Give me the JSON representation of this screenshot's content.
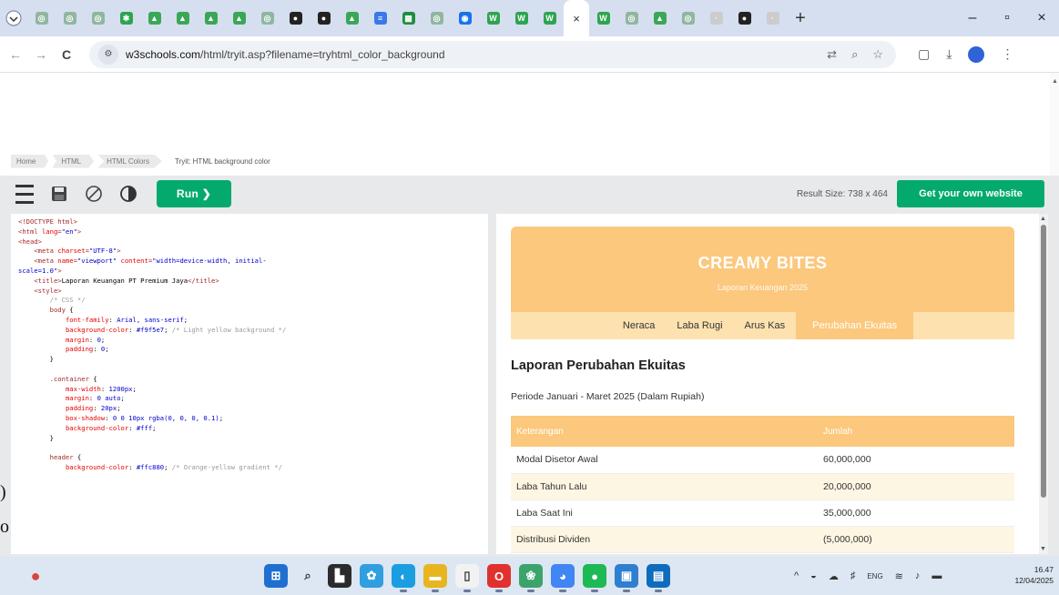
{
  "browser": {
    "tabs": [
      {
        "icon": "w3schools-icon",
        "color": "#8fb7a0",
        "glyph": "◎"
      },
      {
        "icon": "w3schools-icon",
        "color": "#8fb7a0",
        "glyph": "◎"
      },
      {
        "icon": "w3schools-icon",
        "color": "#8fb7a0",
        "glyph": "◎"
      },
      {
        "icon": "green-star-icon",
        "color": "#2ea44f",
        "glyph": "✱"
      },
      {
        "icon": "drive-icon",
        "color": "#3aa757",
        "glyph": "▲"
      },
      {
        "icon": "drive-icon",
        "color": "#3aa757",
        "glyph": "▲"
      },
      {
        "icon": "drive-icon",
        "color": "#3aa757",
        "glyph": "▲"
      },
      {
        "icon": "drive-icon",
        "color": "#3aa757",
        "glyph": "▲"
      },
      {
        "icon": "w3schools-icon",
        "color": "#8fb7a0",
        "glyph": "◎"
      },
      {
        "icon": "openai-icon",
        "color": "#222222",
        "glyph": "●"
      },
      {
        "icon": "openai-icon",
        "color": "#222222",
        "glyph": "●"
      },
      {
        "icon": "drive-icon",
        "color": "#3aa757",
        "glyph": "▲"
      },
      {
        "icon": "docs-icon",
        "color": "#3b78e7",
        "glyph": "≡"
      },
      {
        "icon": "sheets-icon",
        "color": "#1e8e3e",
        "glyph": "▦"
      },
      {
        "icon": "w3schools-icon",
        "color": "#8fb7a0",
        "glyph": "◎"
      },
      {
        "icon": "messenger-icon",
        "color": "#1a73e8",
        "glyph": "◉"
      },
      {
        "icon": "word-icon",
        "color": "#2ea44f",
        "glyph": "W"
      },
      {
        "icon": "word-icon",
        "color": "#2ea44f",
        "glyph": "W"
      },
      {
        "icon": "word-icon",
        "color": "#2ea44f",
        "glyph": "W"
      },
      {
        "icon": "close-icon",
        "color": "active",
        "glyph": "×"
      },
      {
        "icon": "word-icon",
        "color": "#2ea44f",
        "glyph": "W"
      },
      {
        "icon": "w3schools-icon",
        "color": "#8fb7a0",
        "glyph": "◎"
      },
      {
        "icon": "drive-icon",
        "color": "#3aa757",
        "glyph": "▲"
      },
      {
        "icon": "w3schools-icon",
        "color": "#8fb7a0",
        "glyph": "◎"
      },
      {
        "icon": "blank-icon",
        "color": "#cccccc",
        "glyph": "·"
      },
      {
        "icon": "openai-icon",
        "color": "#222222",
        "glyph": "●"
      },
      {
        "icon": "blank-icon",
        "color": "#cccccc",
        "glyph": "·"
      }
    ],
    "new_tab": "+",
    "window_buttons": {
      "minimize": "–",
      "maximize": "▫",
      "close": "×"
    },
    "nav": {
      "back": "←",
      "forward": "→",
      "reload": "C"
    },
    "url_host": "w3schools.com",
    "url_path": "/html/tryit.asp?filename=tryhtml_color_background",
    "url_icons": {
      "translate": "⇄",
      "zoom": "⌕",
      "bookmark": "☆"
    },
    "toolbar_icons": {
      "extensions": "▢",
      "download": "⤓",
      "menu": "⋮"
    }
  },
  "w3": {
    "breadcrumb": [
      "Home",
      "HTML",
      "HTML Colors",
      "Tryit: HTML background color"
    ],
    "run_label": "Run ❯",
    "result_size": "Result Size: 738 x 464",
    "own_site": "Get your own website"
  },
  "code_lines": [
    [
      [
        "tg",
        "<!DOCTYPE html>"
      ]
    ],
    [
      [
        "tg",
        "<html "
      ],
      [
        "at",
        "lang"
      ],
      [
        "tg",
        "="
      ],
      [
        "st",
        "\"en\""
      ],
      [
        "tg",
        ">"
      ]
    ],
    [
      [
        "tg",
        "<head>"
      ]
    ],
    [
      [
        "",
        "    "
      ],
      [
        "tg",
        "<meta "
      ],
      [
        "at",
        "charset"
      ],
      [
        "tg",
        "="
      ],
      [
        "st",
        "\"UTF-8\""
      ],
      [
        "tg",
        ">"
      ]
    ],
    [
      [
        "",
        "    "
      ],
      [
        "tg",
        "<meta "
      ],
      [
        "at",
        "name"
      ],
      [
        "tg",
        "="
      ],
      [
        "st",
        "\"viewport\""
      ],
      [
        "tg",
        " "
      ],
      [
        "at",
        "content"
      ],
      [
        "tg",
        "="
      ],
      [
        "st",
        "\"width=device-width, initial-"
      ]
    ],
    [
      [
        "st",
        "scale=1.0\""
      ],
      [
        "tg",
        ">"
      ]
    ],
    [
      [
        "",
        "    "
      ],
      [
        "tg",
        "<title>"
      ],
      [
        "",
        "Laporan Keuangan PT Premium Jaya"
      ],
      [
        "tg",
        "</title>"
      ]
    ],
    [
      [
        "",
        "    "
      ],
      [
        "tg",
        "<style>"
      ]
    ],
    [
      [
        "",
        "        "
      ],
      [
        "cm",
        "/* CSS */"
      ]
    ],
    [
      [
        "",
        "        "
      ],
      [
        "sel",
        "body"
      ],
      [
        "",
        " {"
      ]
    ],
    [
      [
        "",
        "            "
      ],
      [
        "pr",
        "font-family"
      ],
      [
        "",
        ": "
      ],
      [
        "vl",
        "Arial, sans-serif"
      ],
      [
        "",
        ";"
      ]
    ],
    [
      [
        "",
        "            "
      ],
      [
        "pr",
        "background-color"
      ],
      [
        "",
        ": "
      ],
      [
        "vl",
        "#f9f5e7"
      ],
      [
        "",
        "; "
      ],
      [
        "cm",
        "/* Light yellow background */"
      ]
    ],
    [
      [
        "",
        "            "
      ],
      [
        "pr",
        "margin"
      ],
      [
        "",
        ": "
      ],
      [
        "vl",
        "0"
      ],
      [
        "",
        ";"
      ]
    ],
    [
      [
        "",
        "            "
      ],
      [
        "pr",
        "padding"
      ],
      [
        "",
        ": "
      ],
      [
        "vl",
        "0"
      ],
      [
        "",
        ";"
      ]
    ],
    [
      [
        "",
        "        }"
      ]
    ],
    [
      [
        "",
        ""
      ]
    ],
    [
      [
        "",
        "        "
      ],
      [
        "sel",
        ".container"
      ],
      [
        "",
        " {"
      ]
    ],
    [
      [
        "",
        "            "
      ],
      [
        "pr",
        "max-width"
      ],
      [
        "",
        ": "
      ],
      [
        "vl",
        "1200px"
      ],
      [
        "",
        ";"
      ]
    ],
    [
      [
        "",
        "            "
      ],
      [
        "pr",
        "margin"
      ],
      [
        "",
        ": "
      ],
      [
        "vl",
        "0 auto"
      ],
      [
        "",
        ";"
      ]
    ],
    [
      [
        "",
        "            "
      ],
      [
        "pr",
        "padding"
      ],
      [
        "",
        ": "
      ],
      [
        "vl",
        "20px"
      ],
      [
        "",
        ";"
      ]
    ],
    [
      [
        "",
        "            "
      ],
      [
        "pr",
        "box-shadow"
      ],
      [
        "",
        ": "
      ],
      [
        "vl",
        "0 0 10px rgba(0, 0, 0, 0.1)"
      ],
      [
        "",
        ";"
      ]
    ],
    [
      [
        "",
        "            "
      ],
      [
        "pr",
        "background-color"
      ],
      [
        "",
        ": "
      ],
      [
        "vl",
        "#fff"
      ],
      [
        "",
        ";"
      ]
    ],
    [
      [
        "",
        "        }"
      ]
    ],
    [
      [
        "",
        ""
      ]
    ],
    [
      [
        "",
        "        "
      ],
      [
        "sel",
        "header"
      ],
      [
        "",
        " {"
      ]
    ],
    [
      [
        "",
        "            "
      ],
      [
        "pr",
        "background-color"
      ],
      [
        "",
        ": "
      ],
      [
        "vl",
        "#ffc880"
      ],
      [
        "",
        "; "
      ],
      [
        "cm",
        "/* Orange-yellow gradient */"
      ]
    ]
  ],
  "result": {
    "company": "CREAMY BITES",
    "subtitle": "Laporan Keuangan 2025",
    "nav": [
      "Neraca",
      "Laba Rugi",
      "Arus Kas",
      "Perubahan Ekuitas"
    ],
    "active_nav": 3,
    "heading": "Laporan Perubahan Ekuitas",
    "period": "Periode Januari - Maret 2025 (Dalam Rupiah)",
    "table_headers": [
      "Keterangan",
      "Jumlah"
    ],
    "table_rows": [
      [
        "Modal Disetor Awal",
        "60,000,000"
      ],
      [
        "Laba Tahun Lalu",
        "20,000,000"
      ],
      [
        "Laba Saat Ini",
        "35,000,000"
      ],
      [
        "Distribusi Dividen",
        "(5,000,000)"
      ]
    ],
    "accent": "#fbc87d"
  },
  "edge_glyphs": [
    ")",
    "o"
  ],
  "taskbar": {
    "apps": [
      {
        "name": "start-icon",
        "color": "#1f6fd1",
        "glyph": "⊞"
      },
      {
        "name": "search-icon",
        "color": "transparent",
        "glyph": "⌕"
      },
      {
        "name": "task-view-icon",
        "color": "#2b2b2b",
        "glyph": "▙"
      },
      {
        "name": "widgets-icon",
        "color": "#2f9fe0",
        "glyph": "✿"
      },
      {
        "name": "edge-icon",
        "color": "#1b9de2",
        "glyph": "◐"
      },
      {
        "name": "file-explorer-icon",
        "color": "#e8b520",
        "glyph": "▬"
      },
      {
        "name": "blank-icon",
        "color": "#f2f2f2",
        "glyph": "▯"
      },
      {
        "name": "opera-icon",
        "color": "#e0312e",
        "glyph": "O"
      },
      {
        "name": "copilot-icon",
        "color": "#3ca46b",
        "glyph": "❀"
      },
      {
        "name": "chrome-icon",
        "color": "#4285f4",
        "glyph": "◕"
      },
      {
        "name": "spotify-icon",
        "color": "#1db954",
        "glyph": "●"
      },
      {
        "name": "photos-icon",
        "color": "#2f7fd1",
        "glyph": "▣"
      },
      {
        "name": "outlook-icon",
        "color": "#0f6cbd",
        "glyph": "▤"
      }
    ],
    "tray": [
      "^",
      "◒",
      "☁",
      "♯",
      "ENG",
      "≋",
      "♪",
      "▬"
    ],
    "time": "16.47",
    "date": "12/04/2025"
  }
}
